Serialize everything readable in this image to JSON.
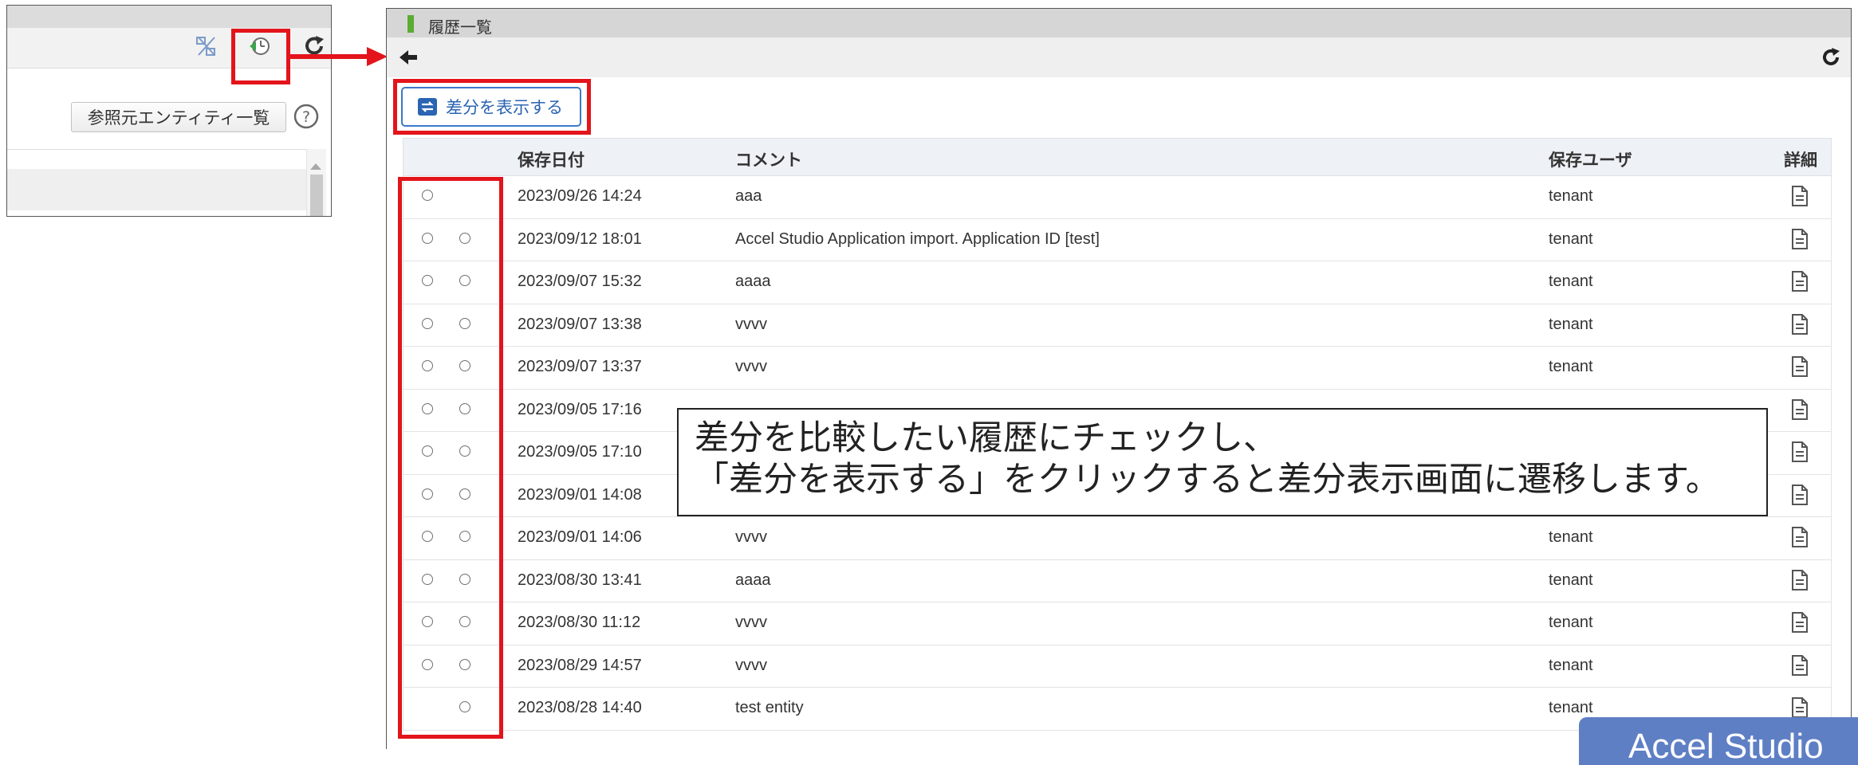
{
  "left_window": {
    "ref_button_label": "参照元エンティティ一覧",
    "icons": [
      "cross-link-icon",
      "history-icon",
      "refresh-icon",
      "help-icon"
    ]
  },
  "main_window": {
    "title": "履歴一覧",
    "diff_button_label": "差分を表示する",
    "columns": {
      "date": "保存日付",
      "comment": "コメント",
      "user": "保存ユーザ",
      "detail": "詳細"
    },
    "rows": [
      {
        "date": "2023/09/26 14:24",
        "comment": "aaa",
        "user": "tenant",
        "radio1": true,
        "radio2": false
      },
      {
        "date": "2023/09/12 18:01",
        "comment": "Accel Studio Application import. Application ID [test]",
        "user": "tenant",
        "radio1": true,
        "radio2": true
      },
      {
        "date": "2023/09/07 15:32",
        "comment": "aaaa",
        "user": "tenant",
        "radio1": true,
        "radio2": true
      },
      {
        "date": "2023/09/07 13:38",
        "comment": "vvvv",
        "user": "tenant",
        "radio1": true,
        "radio2": true
      },
      {
        "date": "2023/09/07 13:37",
        "comment": "vvvv",
        "user": "tenant",
        "radio1": true,
        "radio2": true
      },
      {
        "date": "2023/09/05 17:16",
        "comment": "",
        "user": "",
        "radio1": true,
        "radio2": true
      },
      {
        "date": "2023/09/05 17:10",
        "comment": "",
        "user": "",
        "radio1": true,
        "radio2": true
      },
      {
        "date": "2023/09/01 14:08",
        "comment": "",
        "user": "",
        "radio1": true,
        "radio2": true
      },
      {
        "date": "2023/09/01 14:06",
        "comment": "vvvv",
        "user": "tenant",
        "radio1": true,
        "radio2": true
      },
      {
        "date": "2023/08/30 13:41",
        "comment": "aaaa",
        "user": "tenant",
        "radio1": true,
        "radio2": true
      },
      {
        "date": "2023/08/30 11:12",
        "comment": "vvvv",
        "user": "tenant",
        "radio1": true,
        "radio2": true
      },
      {
        "date": "2023/08/29 14:57",
        "comment": "vvvv",
        "user": "tenant",
        "radio1": true,
        "radio2": true
      },
      {
        "date": "2023/08/28 14:40",
        "comment": "test entity",
        "user": "tenant",
        "radio1": false,
        "radio2": true
      }
    ]
  },
  "callout": {
    "line1": "差分を比較したい履歴にチェックし、",
    "line2": "「差分を表示する」をクリックすると差分表示画面に遷移します。"
  },
  "corner_tag": "Accel Studio",
  "colors": {
    "highlight_red": "#e3141b",
    "accent_blue": "#3c78c8",
    "tag_blue": "#5f7fc5",
    "header_green": "#5cab35"
  }
}
